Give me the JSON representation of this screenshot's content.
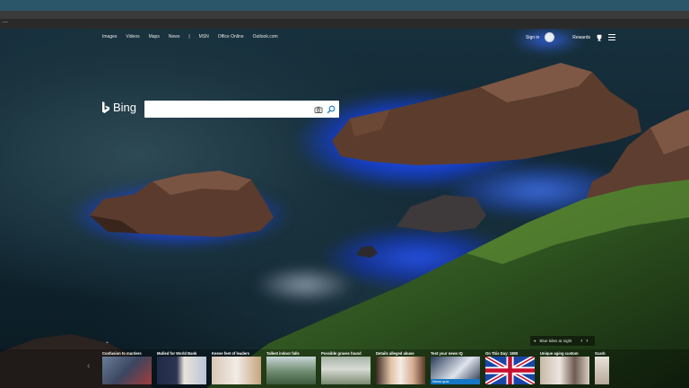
{
  "nav": {
    "links": [
      "Images",
      "Videos",
      "Maps",
      "News",
      "|",
      "MSN",
      "Office Online",
      "Outlook.com"
    ],
    "sign_in": "Sign in",
    "rewards": "Rewards"
  },
  "logo": {
    "text": "Bing"
  },
  "search": {
    "value": "",
    "placeholder": ""
  },
  "image_info": {
    "label": "Blue tides at night"
  },
  "carousel": {
    "cards": [
      {
        "title": "Confusion to murders",
        "tag": ""
      },
      {
        "title": "Mulled for World Bank",
        "tag": ""
      },
      {
        "title": "Keene feet of leaders",
        "tag": ""
      },
      {
        "title": "Tallest indoor falls",
        "tag": ""
      },
      {
        "title": "Possible graves found",
        "tag": ""
      },
      {
        "title": "Details alleged abuse",
        "tag": ""
      },
      {
        "title": "Test your news IQ",
        "tag": "News quiz"
      },
      {
        "title": "On This Day: 1800",
        "tag": ""
      },
      {
        "title": "Unique aging custom",
        "tag": ""
      },
      {
        "title": "Scarb",
        "tag": ""
      }
    ]
  },
  "colors": {
    "accent": "#1476c4",
    "glow": "#1e5bff"
  }
}
